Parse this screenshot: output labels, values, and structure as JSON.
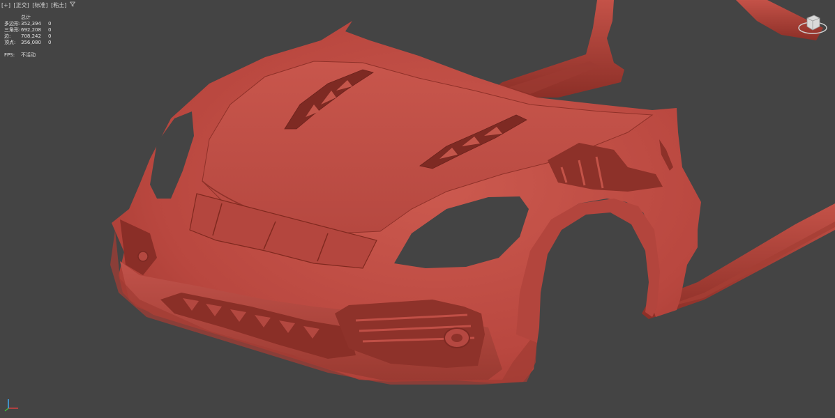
{
  "viewport": {
    "labels": [
      "[+]",
      "[正交]",
      "[标准]",
      "[粘土]"
    ],
    "filter_icon": "funnel-icon",
    "background": "#444444",
    "model_color": "#c25048"
  },
  "stats": {
    "header": "总计",
    "rows": [
      {
        "label": "多边形:",
        "value": "352,394",
        "selected": "0"
      },
      {
        "label": "三角形:",
        "value": "692,208",
        "selected": "0"
      },
      {
        "label": "边:",
        "value": "708,242",
        "selected": "0"
      },
      {
        "label": "顶点:",
        "value": "356,080",
        "selected": "0"
      }
    ],
    "fps_label": "FPS:",
    "fps_value": "不活动"
  },
  "icons": {
    "viewcube": "viewcube-icon",
    "axis": "axis-tripod-icon"
  }
}
